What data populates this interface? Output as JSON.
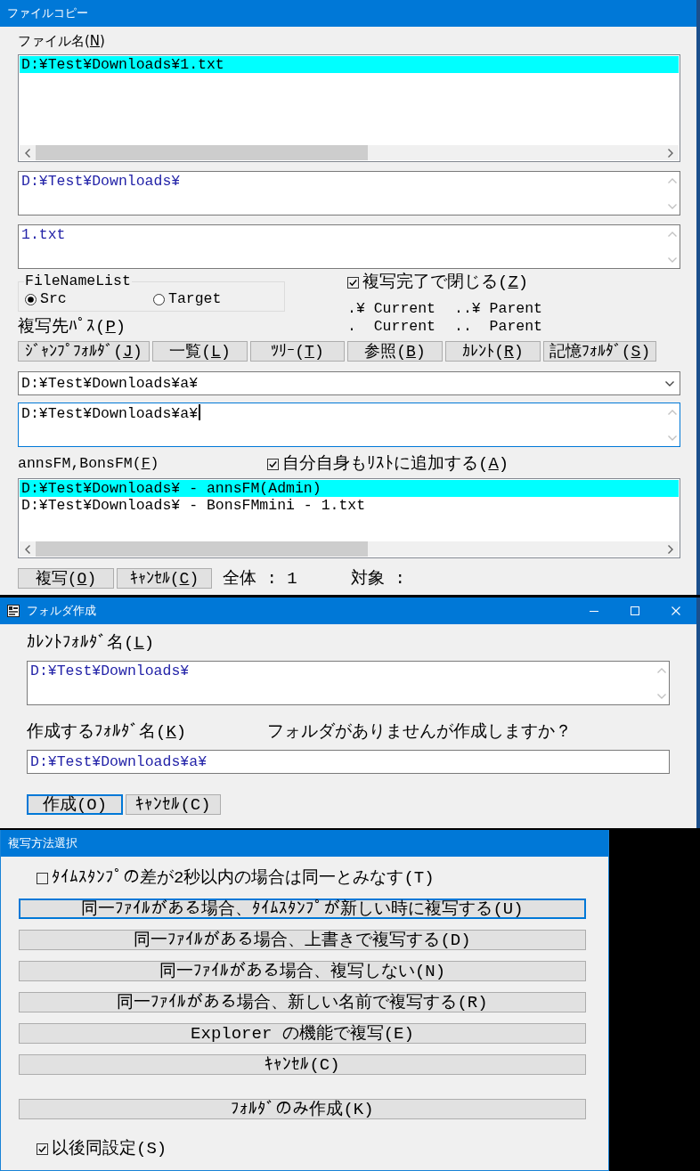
{
  "file_copy_window": {
    "title": "ファイルコピー",
    "caption_buttons": false,
    "file_name_label": {
      "before": "ファイル名(",
      "key": "N",
      "after": ")"
    },
    "file_list": {
      "items": [
        {
          "text": "D:¥Test¥Downloads¥1.txt",
          "selected": true
        }
      ]
    },
    "folder_field": {
      "value": "D:¥Test¥Downloads¥",
      "readonly": true
    },
    "name_field": {
      "value": "1.txt",
      "readonly": true
    },
    "file_name_list": {
      "legend": "FileNameList",
      "options": [
        {
          "label": "Src",
          "selected": true
        },
        {
          "label": "Target",
          "selected": false
        }
      ]
    },
    "close_when_done": {
      "label": {
        "before": "複写完了で閉じる(",
        "key": "Z",
        "after": ")"
      },
      "checked": true
    },
    "path_hints": [
      ".¥ Current",
      "..¥ Parent",
      ".  Current",
      "..  Parent"
    ],
    "destination_label": {
      "before": "複写先ﾊﾟｽ(",
      "key": "P",
      "after": ")"
    },
    "path_buttons": [
      {
        "label": {
          "before": "ｼﾞｬﾝﾌﾟﾌｫﾙﾀﾞ(",
          "key": "J",
          "after": ")"
        }
      },
      {
        "label": {
          "before": "一覧(",
          "key": "L",
          "after": ")"
        }
      },
      {
        "label": {
          "before": "ﾂﾘｰ(",
          "key": "T",
          "after": ")"
        }
      },
      {
        "label": {
          "before": "参照(",
          "key": "B",
          "after": ")"
        }
      },
      {
        "label": {
          "before": "ｶﾚﾝﾄ(",
          "key": "R",
          "after": ")"
        }
      },
      {
        "label": {
          "before": "記憶ﾌｫﾙﾀﾞ(",
          "key": "S",
          "after": ")"
        }
      }
    ],
    "destination_combo": {
      "value": "D:¥Test¥Downloads¥a¥",
      "readonly": false
    },
    "destination_field": {
      "value": "D:¥Test¥Downloads¥a¥",
      "readonly": false,
      "focused": true
    },
    "file_manager_label": {
      "before": "annsFM,BonsFM(",
      "key": "F",
      "after": ")"
    },
    "add_self": {
      "label": {
        "before": "自分自身もﾘｽﾄに追加する(",
        "key": "A",
        "after": ")"
      },
      "checked": true
    },
    "file_manager_list": {
      "items": [
        {
          "text": "D:¥Test¥Downloads¥ - annsFM(Admin)",
          "selected": true
        },
        {
          "text": "D:¥Test¥Downloads¥ - BonsFMmini - 1.txt",
          "selected": false
        }
      ]
    },
    "buttons": [
      {
        "label": {
          "before": "複写(",
          "key": "O",
          "after": ")"
        }
      },
      {
        "label": {
          "before": "ｷｬﾝｾﾙ(",
          "key": "C",
          "after": ")"
        }
      }
    ],
    "total": "全体 : 1",
    "target": "対象 :"
  },
  "create_folder_window": {
    "title": "フォルダ作成",
    "caption_buttons": true,
    "current_folder_label": {
      "before": "ｶﾚﾝﾄﾌｫﾙﾀﾞ名(",
      "key": "L",
      "after": ")"
    },
    "current_folder_field": {
      "value": "D:¥Test¥Downloads¥",
      "readonly": true
    },
    "new_folder_label": {
      "before": "作成するﾌｫﾙﾀﾞ名(",
      "key": "K",
      "after": ")"
    },
    "message": "フォルダがありませんが作成しますか？",
    "new_folder_field": {
      "value": "D:¥Test¥Downloads¥a¥",
      "readonly": true
    },
    "buttons": [
      {
        "label": "作成(O)",
        "focused": true
      },
      {
        "label": "ｷｬﾝｾﾙ(C)",
        "focused": false
      }
    ]
  },
  "copy_method_window": {
    "title": "複写方法選択",
    "caption_buttons": false,
    "same_timestamp": {
      "label": "ﾀｲﾑｽﾀﾝﾌﾟの差が2秒以内の場合は同一とみなす(T)",
      "checked": false
    },
    "buttons": [
      {
        "label": "同一ﾌｧｲﾙがある場合、ﾀｲﾑｽﾀﾝﾌﾟが新しい時に複写する(U)",
        "focused": true
      },
      {
        "label": "同一ﾌｧｲﾙがある場合、上書きで複写する(D)",
        "focused": false
      },
      {
        "label": "同一ﾌｧｲﾙがある場合、複写しない(N)",
        "focused": false
      },
      {
        "label": "同一ﾌｧｲﾙがある場合、新しい名前で複写する(R)",
        "focused": false
      },
      {
        "label": "Explorer の機能で複写(E)",
        "focused": false
      },
      {
        "label": "ｷｬﾝｾﾙ(C)",
        "focused": false
      }
    ],
    "folder_only_button": {
      "label": "ﾌｫﾙﾀﾞのみ作成(K)",
      "focused": false
    },
    "remember": {
      "label": "以後同設定(S)",
      "checked": true
    }
  }
}
